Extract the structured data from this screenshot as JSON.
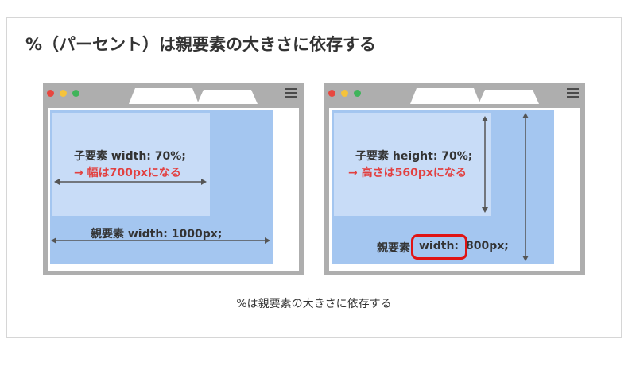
{
  "title": "%（パーセント）は親要素の大きさに依存する",
  "caption": "%は親要素の大きさに依存する",
  "colors": {
    "frame": "#aeaeae",
    "parent_box": "#a4c6f0",
    "child_box": "#c8dcf7",
    "accent_red": "#e24040",
    "highlight_red": "#e01414",
    "arrow": "#555555",
    "dot_red": "#e8473f",
    "dot_yellow": "#f5c33b",
    "dot_green": "#3fb45a"
  },
  "icons": [
    "window-dot",
    "menu-icon",
    "double-arrow"
  ],
  "left_diagram": {
    "child_line1": "子要素 width: 70%;",
    "child_line2": "→ 幅は700pxになる",
    "parent_line": "親要素 width: 1000px;"
  },
  "right_diagram": {
    "child_line1": "子要素 height: 70%;",
    "child_line2": "→ 高さは560pxになる",
    "parent_prefix": "親要素",
    "parent_highlight": "width:",
    "parent_suffix": "800px;"
  }
}
